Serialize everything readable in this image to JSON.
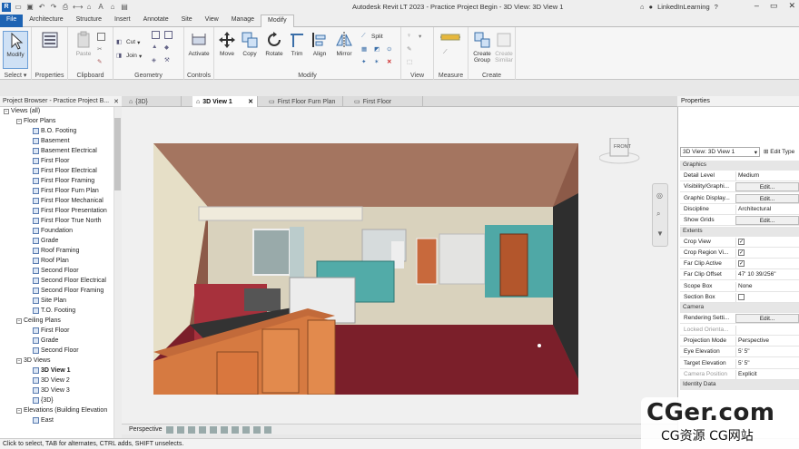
{
  "app": {
    "title": "Autodesk Revit LT 2023 - Practice Project Begin - 3D View: 3D View 1",
    "user": "LinkedInLearning"
  },
  "colors": {
    "file_tab": "#1d63b3",
    "wall_floor": "#7c2a30",
    "teal": "#5aa9a8",
    "cabinet": "#d8783c"
  },
  "tabs": [
    "File",
    "Architecture",
    "Structure",
    "Insert",
    "Annotate",
    "Site",
    "View",
    "Manage",
    "Modify"
  ],
  "active_tab": "Modify",
  "ribbon": {
    "select": {
      "modify": "Modify",
      "label": "Select ▾"
    },
    "properties": {
      "label": "Properties"
    },
    "clipboard": {
      "paste": "Paste",
      "label": "Clipboard"
    },
    "geometry": {
      "cut": "Cut",
      "join": "Join",
      "label": "Geometry"
    },
    "controls": {
      "activate": "Activate",
      "label": "Controls"
    },
    "modify": {
      "move": "Move",
      "copy": "Copy",
      "rotate": "Rotate",
      "trim": "Trim",
      "align": "Align",
      "mirror": "Mirror",
      "split": "Split",
      "label": "Modify"
    },
    "view": {
      "label": "View"
    },
    "measure": {
      "label": "Measure"
    },
    "create": {
      "create_group": "Create Group",
      "create_similar": "Create Similar",
      "label": "Create"
    }
  },
  "project_browser": {
    "title": "Project Browser - Practice Project B...",
    "root": "Views (all)",
    "floor_plans_label": "Floor Plans",
    "floor_plans": [
      "B.O. Footing",
      "Basement",
      "Basement Electrical",
      "First Floor",
      "First Floor Electrical",
      "First Floor Framing",
      "First Floor Furn Plan",
      "First Floor Mechanical",
      "First Floor Presentation",
      "First Floor True North",
      "Foundation",
      "Grade",
      "Roof Framing",
      "Roof Plan",
      "Second Floor",
      "Second Floor Electrical",
      "Second Floor Framing",
      "Site Plan",
      "T.O. Footing"
    ],
    "ceiling_plans_label": "Ceiling Plans",
    "ceiling_plans": [
      "First Floor",
      "Grade",
      "Second Floor"
    ],
    "views_3d_label": "3D Views",
    "views_3d": [
      "3D View 1",
      "3D View 2",
      "3D View 3",
      "{3D}"
    ],
    "elevations_label": "Elevations (Building Elevation",
    "elevations": [
      "East"
    ]
  },
  "view_tabs": [
    "{3D}",
    "3D View 1",
    "First Floor Furn Plan",
    "First Floor"
  ],
  "active_view_tab": "3D View 1",
  "viewcube": {
    "face": "FRONT"
  },
  "view_control": {
    "mode": "Perspective"
  },
  "properties": {
    "title": "Properties",
    "type_selector": "3D View: 3D View 1",
    "edit_type": "Edit Type",
    "graphics_label": "Graphics",
    "graphics": [
      {
        "name": "Detail Level",
        "value": "Medium"
      },
      {
        "name": "Visibility/Graphi...",
        "value": "Edit...",
        "button": true
      },
      {
        "name": "Graphic Display...",
        "value": "Edit...",
        "button": true
      },
      {
        "name": "Discipline",
        "value": "Architectural"
      },
      {
        "name": "Show Grids",
        "value": "Edit...",
        "button": true
      }
    ],
    "extents_label": "Extents",
    "extents": [
      {
        "name": "Crop View",
        "value": "✓",
        "check": true
      },
      {
        "name": "Crop Region Vi...",
        "value": "✓",
        "check": true
      },
      {
        "name": "Far Clip Active",
        "value": "✓",
        "check": true
      },
      {
        "name": "Far Clip Offset",
        "value": "47'  10 39/256\""
      },
      {
        "name": "Scope Box",
        "value": "None"
      },
      {
        "name": "Section Box",
        "value": "",
        "check": true
      }
    ],
    "camera_label": "Camera",
    "camera": [
      {
        "name": "Rendering Setti...",
        "value": "Edit...",
        "button": true
      },
      {
        "name": "Locked Orienta...",
        "value": "",
        "dim": true
      },
      {
        "name": "Projection Mode",
        "value": "Perspective"
      },
      {
        "name": "Eye Elevation",
        "value": "5'  5\""
      },
      {
        "name": "Target Elevation",
        "value": "5'  5\""
      },
      {
        "name": "Camera Position",
        "value": "Explicit",
        "dim": true
      }
    ],
    "identity_label": "Identity Data"
  },
  "status": "Click to select, TAB for alternates, CTRL adds, SHIFT unselects.",
  "watermark": {
    "main": "CGer.com",
    "sub": "CG资源 CG网站"
  }
}
